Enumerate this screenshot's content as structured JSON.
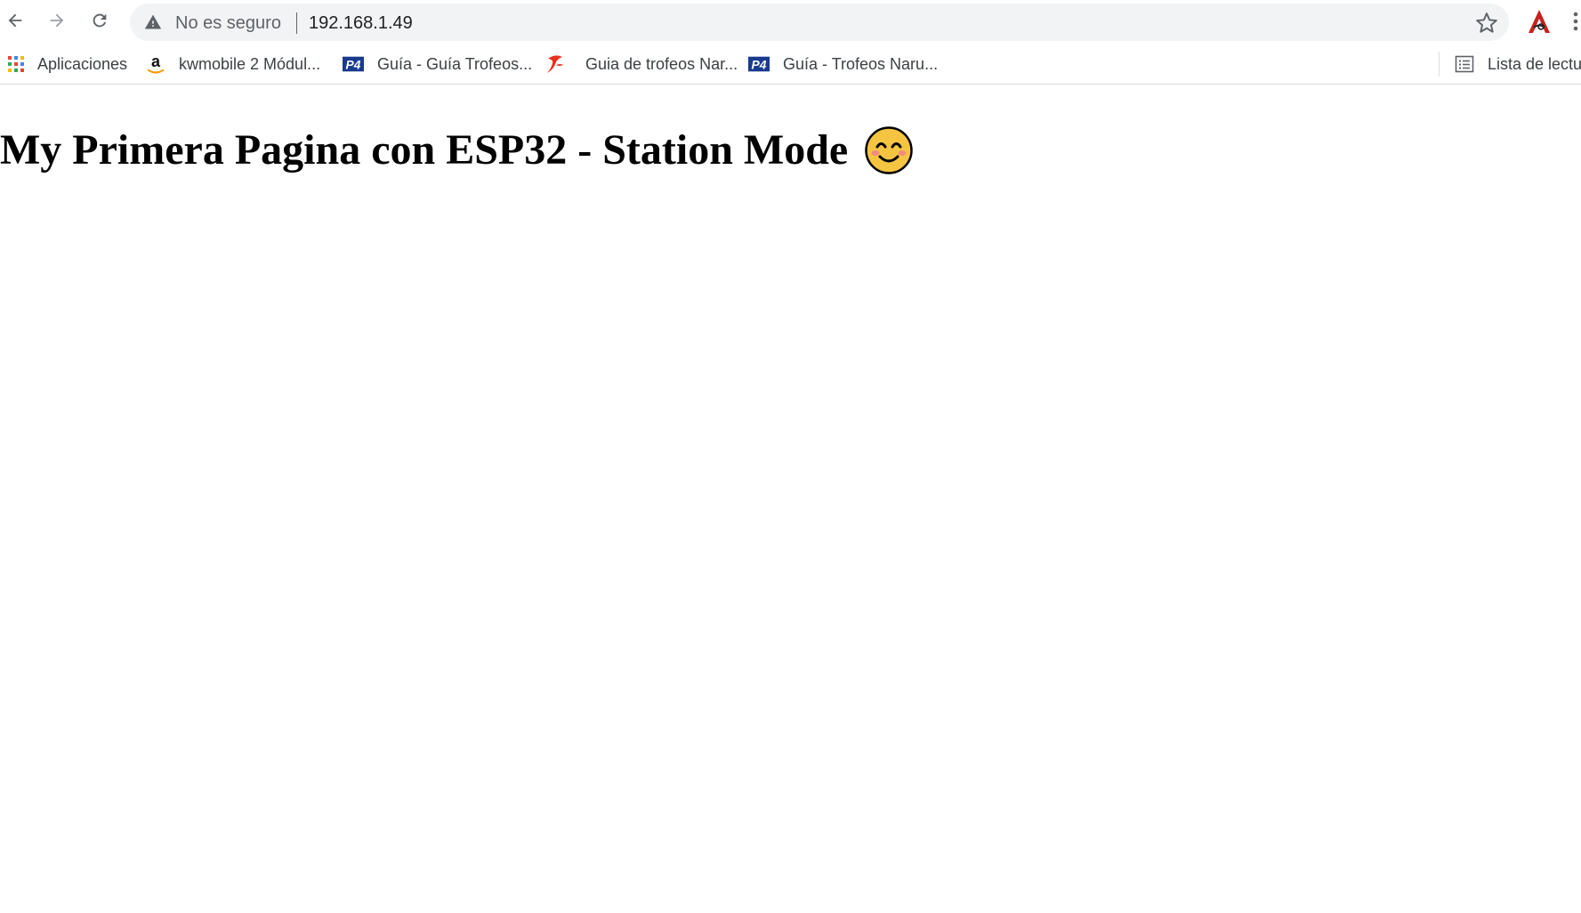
{
  "browser": {
    "nav": {
      "back_icon": "arrow-left-icon",
      "forward_icon": "arrow-right-icon",
      "reload_icon": "reload-icon"
    },
    "omnibox": {
      "security_icon": "warning-triangle-icon",
      "security_text": "No es seguro",
      "url": "192.168.1.49",
      "bookmark_icon": "star-outline-icon"
    },
    "extension_icon": "red-a-extension-icon",
    "menu_icon": "kebab-menu-icon"
  },
  "bookmarks": {
    "items": [
      {
        "label": "Aplicaciones",
        "icon": "apps-grid-icon"
      },
      {
        "label": "kwmobile 2 Módul...",
        "icon": "amazon-icon"
      },
      {
        "label": "Guía - Guía Trofeos...",
        "icon": "p4-icon"
      },
      {
        "label": "Guia de trofeos Nar...",
        "icon": "swirl-red-icon"
      },
      {
        "label": "Guía - Trofeos Naru...",
        "icon": "p4-icon"
      }
    ],
    "reading_list": {
      "label": "Lista de lectura",
      "icon": "reading-list-icon"
    }
  },
  "page": {
    "heading": "My Primera Pagina con ESP32 - Station Mode",
    "heading_emoji": "smiling-face-icon"
  },
  "colors": {
    "omnibox_bg": "#f1f3f4",
    "icon_gray": "#5f6368",
    "p4_blue": "#1a3a8f",
    "extension_red": "#c5221f",
    "emoji_yellow": "#f5c542"
  }
}
